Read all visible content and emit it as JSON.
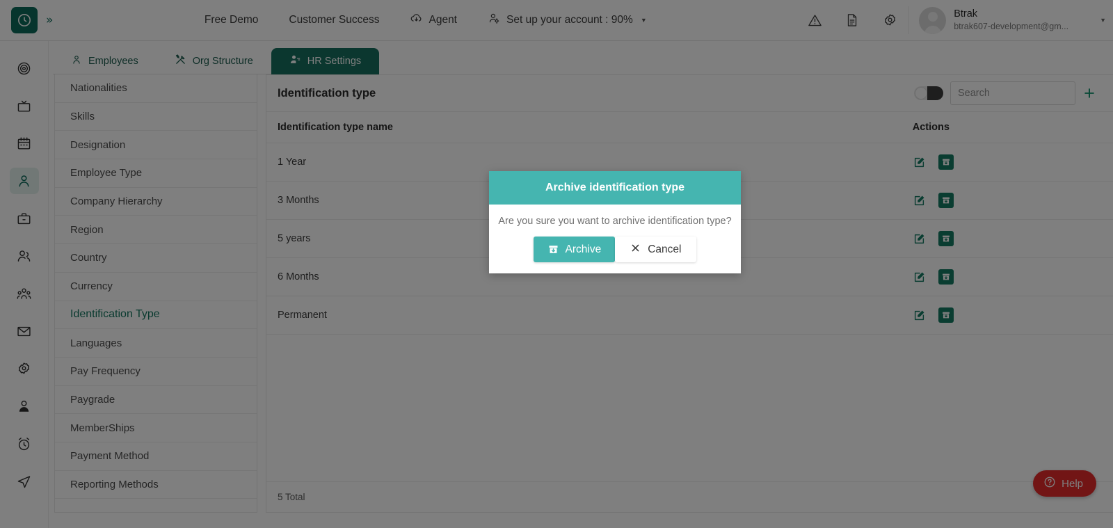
{
  "header": {
    "brand_icon": "clock-logo-icon",
    "expand_icon": "chevron-double-right-icon",
    "nav": [
      {
        "label": "Free Demo",
        "icon": null
      },
      {
        "label": "Customer Success",
        "icon": null
      },
      {
        "label": "Agent",
        "icon": "cloud-download-icon"
      },
      {
        "label": "Set up your account : 90%",
        "icon": "user-gear-icon",
        "caret": "▾"
      }
    ],
    "icons": [
      {
        "name": "warning-triangle-icon"
      },
      {
        "name": "document-icon"
      },
      {
        "name": "gear-icon"
      }
    ],
    "user": {
      "name": "Btrak",
      "email": "btrak607-development@gm...",
      "caret": "▾",
      "avatar_icon": "avatar-placeholder-icon"
    }
  },
  "rail": {
    "items": [
      {
        "name": "target-icon",
        "active": false
      },
      {
        "name": "tv-icon",
        "active": false
      },
      {
        "name": "calendar-icon",
        "active": false
      },
      {
        "name": "user-icon",
        "active": true
      },
      {
        "name": "briefcase-icon",
        "active": false
      },
      {
        "name": "users-icon",
        "active": false
      },
      {
        "name": "group-icon",
        "active": false
      },
      {
        "name": "mail-icon",
        "active": false
      },
      {
        "name": "settings-gear-icon",
        "active": false
      },
      {
        "name": "person-icon",
        "active": false
      },
      {
        "name": "alarm-clock-icon",
        "active": false
      },
      {
        "name": "send-icon",
        "active": false
      }
    ]
  },
  "tabs": [
    {
      "label": "Employees",
      "icon": "person-icon",
      "active": false
    },
    {
      "label": "Org Structure",
      "icon": "tools-icon",
      "active": false
    },
    {
      "label": "HR Settings",
      "icon": "user-settings-icon",
      "active": true
    }
  ],
  "settings_sidebar": {
    "items": [
      {
        "label": "Nationalities",
        "active": false
      },
      {
        "label": "Skills",
        "active": false
      },
      {
        "label": "Designation",
        "active": false
      },
      {
        "label": "Employee Type",
        "active": false
      },
      {
        "label": "Company Hierarchy",
        "active": false
      },
      {
        "label": "Region",
        "active": false
      },
      {
        "label": "Country",
        "active": false
      },
      {
        "label": "Currency",
        "active": false
      },
      {
        "label": "Identification Type",
        "active": true
      },
      {
        "label": "Languages",
        "active": false
      },
      {
        "label": "Pay Frequency",
        "active": false
      },
      {
        "label": "Paygrade",
        "active": false
      },
      {
        "label": "MemberShips",
        "active": false
      },
      {
        "label": "Payment Method",
        "active": false
      },
      {
        "label": "Reporting Methods",
        "active": false
      }
    ]
  },
  "main": {
    "title": "Identification type",
    "toggle_on": false,
    "search_placeholder": "Search",
    "search_value": "",
    "add_label": "+",
    "columns": [
      "Identification type name",
      "Actions"
    ],
    "rows": [
      {
        "name": "1 Year"
      },
      {
        "name": "3 Months"
      },
      {
        "name": "5 years"
      },
      {
        "name": "6 Months"
      },
      {
        "name": "Permanent"
      }
    ],
    "row_actions": {
      "edit_icon": "edit-pencil-icon",
      "archive_icon": "archive-box-icon"
    },
    "footer_total": "5 Total"
  },
  "modal": {
    "title": "Archive identification type",
    "message": "Are you sure you want to archive identification type?",
    "confirm_label": "Archive",
    "confirm_icon": "archive-box-icon",
    "cancel_label": "Cancel",
    "cancel_icon": "close-x-icon"
  },
  "help": {
    "label": "Help",
    "icon": "question-circle-icon"
  },
  "colors": {
    "brand_dark_green": "#0d6a5a",
    "tab_active": "#166f5f",
    "accent_teal": "#45b5b0",
    "action_green": "#157a63",
    "help_red": "#e52a2a",
    "active_link": "#13755f"
  }
}
